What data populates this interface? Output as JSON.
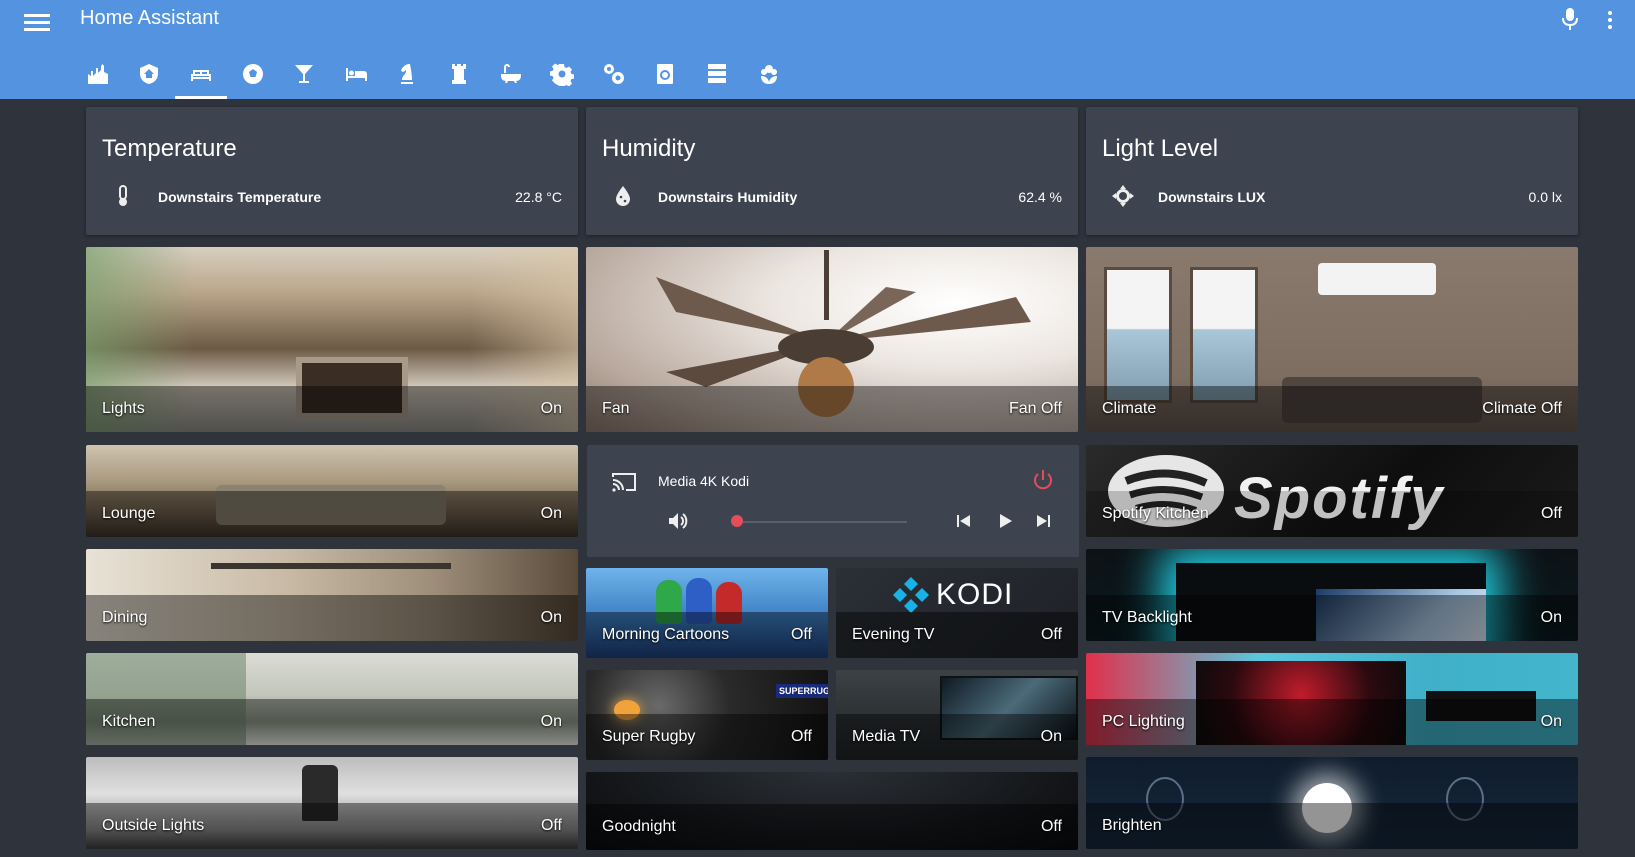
{
  "app": {
    "title": "Home Assistant"
  },
  "header": {
    "menu_icon": "hamburger-icon",
    "mic_icon": "microphone-icon",
    "more_icon": "more-vert-icon",
    "tabs": [
      {
        "name": "tab-castle",
        "icon": "castle-icon",
        "active": false
      },
      {
        "name": "tab-shield",
        "icon": "shield-home-icon",
        "active": false
      },
      {
        "name": "tab-sofa",
        "icon": "sofa-icon",
        "active": true
      },
      {
        "name": "tab-soccer",
        "icon": "soccer-icon",
        "active": false
      },
      {
        "name": "tab-glass",
        "icon": "glass-cocktail-icon",
        "active": false
      },
      {
        "name": "tab-bed",
        "icon": "bed-icon",
        "active": false
      },
      {
        "name": "tab-chess-knight",
        "icon": "chess-knight-icon",
        "active": false
      },
      {
        "name": "tab-chess-rook",
        "icon": "chess-rook-icon",
        "active": false
      },
      {
        "name": "tab-bathtub",
        "icon": "bathtub-icon",
        "active": false
      },
      {
        "name": "tab-settings",
        "icon": "gear-icon",
        "active": false
      },
      {
        "name": "tab-settings-multi",
        "icon": "gears-icon",
        "active": false
      },
      {
        "name": "tab-washer",
        "icon": "washing-machine-icon",
        "active": false
      },
      {
        "name": "tab-server",
        "icon": "server-icon",
        "active": false
      },
      {
        "name": "tab-flower",
        "icon": "flower-icon",
        "active": false
      }
    ]
  },
  "sensors": {
    "temperature": {
      "title": "Temperature",
      "name": "Downstairs Temperature",
      "value": "22.8 °C",
      "icon": "thermometer-icon"
    },
    "humidity": {
      "title": "Humidity",
      "name": "Downstairs Humidity",
      "value": "62.4 %",
      "icon": "water-percent-icon"
    },
    "light": {
      "title": "Light Level",
      "name": "Downstairs LUX",
      "value": "0.0 lx",
      "icon": "brightness-icon"
    }
  },
  "tiles": {
    "lights": {
      "label": "Lights",
      "state": "On"
    },
    "fan": {
      "label": "Fan",
      "state": "Fan Off"
    },
    "climate": {
      "label": "Climate",
      "state": "Climate Off"
    },
    "lounge": {
      "label": "Lounge",
      "state": "On"
    },
    "spotify": {
      "label": "Spotify Kitchen",
      "state": "Off",
      "brand": "Spotify"
    },
    "dining": {
      "label": "Dining",
      "state": "On"
    },
    "morning": {
      "label": "Morning Cartoons",
      "state": "Off"
    },
    "evening": {
      "label": "Evening TV",
      "state": "Off",
      "brand": "KODI"
    },
    "tv_backlight": {
      "label": "TV Backlight",
      "state": "On"
    },
    "kitchen": {
      "label": "Kitchen",
      "state": "On"
    },
    "rugby": {
      "label": "Super Rugby",
      "state": "Off",
      "brand": "SUPERRUGBY"
    },
    "media_tv": {
      "label": "Media TV",
      "state": "On"
    },
    "pc_lighting": {
      "label": "PC Lighting",
      "state": "On"
    },
    "outside": {
      "label": "Outside Lights",
      "state": "Off"
    },
    "goodnight": {
      "label": "Goodnight",
      "state": "Off"
    },
    "brighten": {
      "label": "Brighten",
      "state": ""
    }
  },
  "media_player": {
    "title": "Media 4K Kodi",
    "volume_fraction": 0.0,
    "cast_icon": "cast-icon",
    "power_icon": "power-icon",
    "volume_icon": "volume-high-icon",
    "prev_icon": "skip-previous-icon",
    "play_icon": "play-icon",
    "next_icon": "skip-next-icon"
  },
  "colors": {
    "header": "#5393e0",
    "background": "#2e333c",
    "card": "#3d434f",
    "power": "#e74c5b"
  }
}
